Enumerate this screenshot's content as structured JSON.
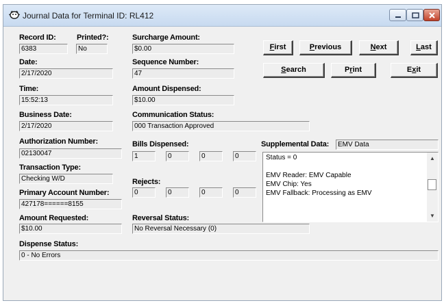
{
  "window": {
    "title": "Journal Data for Terminal ID: RL412",
    "icon": "journal-app-icon",
    "controls": [
      "minimize",
      "maximize",
      "close"
    ]
  },
  "labels": {
    "record_id": "Record ID:",
    "printed": "Printed?:",
    "surcharge_amount": "Surcharge Amount:",
    "date": "Date:",
    "sequence_number": "Sequence Number:",
    "time": "Time:",
    "amount_dispensed": "Amount Dispensed:",
    "business_date": "Business Date:",
    "communication_status": "Communication Status:",
    "authorization_number": "Authorization Number:",
    "bills_dispensed": "Bills Dispensed:",
    "supplemental_data": "Supplemental Data:",
    "transaction_type": "Transaction Type:",
    "rejects": "Rejects:",
    "primary_account_number": "Primary Account Number:",
    "amount_requested": "Amount Requested:",
    "reversal_status": "Reversal Status:",
    "dispense_status": "Dispense Status:"
  },
  "fields": {
    "record_id": "6383",
    "printed": "No",
    "surcharge_amount": "$0.00",
    "date": "2/17/2020",
    "sequence_number": "47",
    "time": "15:52:13",
    "amount_dispensed": "$10.00",
    "business_date": "2/17/2020",
    "communication_status": "000 Transaction Approved",
    "authorization_number": "02130047",
    "transaction_type": "Checking W/D",
    "primary_account_number": "427178======8155",
    "amount_requested": "$10.00",
    "reversal_status": "No Reversal Necessary (0)",
    "dispense_status": "0 - No Errors",
    "supplemental_type": "EMV Data"
  },
  "bills_dispensed": [
    "1",
    "0",
    "0",
    "0"
  ],
  "rejects": [
    "0",
    "0",
    "0",
    "0"
  ],
  "supplemental_lines": [
    "Status = 0",
    "",
    "EMV Reader: EMV Capable",
    "EMV Chip: Yes",
    "EMV Fallback: Processing as EMV"
  ],
  "buttons": {
    "first": {
      "pre": "",
      "u": "F",
      "post": "irst"
    },
    "previous": {
      "pre": "",
      "u": "P",
      "post": "revious"
    },
    "next": {
      "pre": "",
      "u": "N",
      "post": "ext"
    },
    "last": {
      "pre": "",
      "u": "L",
      "post": "ast"
    },
    "search": {
      "pre": "",
      "u": "S",
      "post": "earch"
    },
    "print": {
      "pre": "P",
      "u": "r",
      "post": "int"
    },
    "exit": {
      "pre": "E",
      "u": "x",
      "post": "it"
    }
  }
}
